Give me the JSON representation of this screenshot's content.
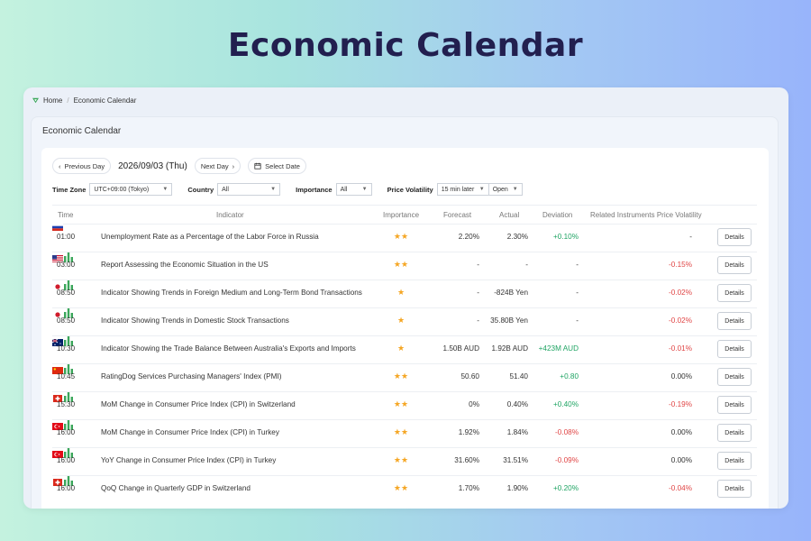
{
  "hero": {
    "title": "Economic Calendar"
  },
  "breadcrumb": {
    "home": "Home",
    "current": "Economic Calendar"
  },
  "panel": {
    "title": "Economic Calendar"
  },
  "nav": {
    "prev": "Previous Day",
    "date": "2026/09/03 (Thu)",
    "next": "Next Day",
    "select_date": "Select Date"
  },
  "filters": {
    "timezone_label": "Time Zone",
    "timezone_value": "UTC+09:00 (Tokyo)",
    "country_label": "Country",
    "country_value": "All",
    "importance_label": "Importance",
    "importance_value": "All",
    "volatility_label": "Price Volatility",
    "volatility_time": "15 min later",
    "volatility_price": "Open"
  },
  "columns": {
    "time": "Time",
    "indicator": "Indicator",
    "importance": "Importance",
    "forecast": "Forecast",
    "actual": "Actual",
    "deviation": "Deviation",
    "related": "Related Instruments Price Volatility"
  },
  "details_label": "Details",
  "colors": {
    "positive": "#1fa463",
    "negative": "#e04545",
    "star": "#f5a623",
    "bars": "#3aa65a"
  },
  "rows": [
    {
      "time": "01:00",
      "flag": "russia-flag",
      "indicator": "Unemployment Rate as a Percentage of the Labor Force in Russia",
      "importance": "★★",
      "forecast": "2.20%",
      "actual": "2.30%",
      "deviation": "+0.10%",
      "deviation_tone": "pos",
      "volatility": "-",
      "volatility_tone": "neu",
      "bars": false
    },
    {
      "time": "03:00",
      "flag": "usa-flag",
      "indicator": "Report Assessing the Economic Situation in the US",
      "importance": "★★",
      "forecast": "-",
      "actual": "-",
      "deviation": "-",
      "deviation_tone": "neu",
      "volatility": "-0.15%",
      "volatility_tone": "neg",
      "bars": true
    },
    {
      "time": "08:50",
      "flag": "japan-flag",
      "indicator": "Indicator Showing Trends in Foreign Medium and Long-Term Bond Transactions",
      "importance": "★",
      "forecast": "-",
      "actual": "-824B Yen",
      "deviation": "-",
      "deviation_tone": "neu",
      "volatility": "-0.02%",
      "volatility_tone": "neg",
      "bars": true
    },
    {
      "time": "08:50",
      "flag": "japan-flag",
      "indicator": "Indicator Showing Trends in Domestic Stock Transactions",
      "importance": "★",
      "forecast": "-",
      "actual": "35.80B Yen",
      "deviation": "-",
      "deviation_tone": "neu",
      "volatility": "-0.02%",
      "volatility_tone": "neg",
      "bars": true
    },
    {
      "time": "10:30",
      "flag": "australia-flag",
      "indicator": "Indicator Showing the Trade Balance Between Australia's Exports and Imports",
      "importance": "★",
      "forecast": "1.50B AUD",
      "actual": "1.92B AUD",
      "deviation": "+423M AUD",
      "deviation_tone": "pos",
      "volatility": "-0.01%",
      "volatility_tone": "neg",
      "bars": true
    },
    {
      "time": "10:45",
      "flag": "china-flag",
      "indicator": "RatingDog Services Purchasing Managers' Index (PMI)",
      "importance": "★★",
      "forecast": "50.60",
      "actual": "51.40",
      "deviation": "+0.80",
      "deviation_tone": "pos",
      "volatility": "0.00%",
      "volatility_tone": "neu",
      "bars": true
    },
    {
      "time": "15:30",
      "flag": "switzerland-flag",
      "indicator": "MoM Change in Consumer Price Index (CPI) in Switzerland",
      "importance": "★★",
      "forecast": "0%",
      "actual": "0.40%",
      "deviation": "+0.40%",
      "deviation_tone": "pos",
      "volatility": "-0.19%",
      "volatility_tone": "neg",
      "bars": true
    },
    {
      "time": "16:00",
      "flag": "turkey-flag",
      "indicator": "MoM Change in Consumer Price Index (CPI) in Turkey",
      "importance": "★★",
      "forecast": "1.92%",
      "actual": "1.84%",
      "deviation": "-0.08%",
      "deviation_tone": "neg",
      "volatility": "0.00%",
      "volatility_tone": "neu",
      "bars": true
    },
    {
      "time": "16:00",
      "flag": "turkey-flag",
      "indicator": "YoY Change in Consumer Price Index (CPI) in Turkey",
      "importance": "★★",
      "forecast": "31.60%",
      "actual": "31.51%",
      "deviation": "-0.09%",
      "deviation_tone": "neg",
      "volatility": "0.00%",
      "volatility_tone": "neu",
      "bars": true
    },
    {
      "time": "16:00",
      "flag": "switzerland-flag",
      "indicator": "QoQ Change in Quarterly GDP in Switzerland",
      "importance": "★★",
      "forecast": "1.70%",
      "actual": "1.90%",
      "deviation": "+0.20%",
      "deviation_tone": "pos",
      "volatility": "-0.04%",
      "volatility_tone": "neg",
      "bars": true
    }
  ]
}
